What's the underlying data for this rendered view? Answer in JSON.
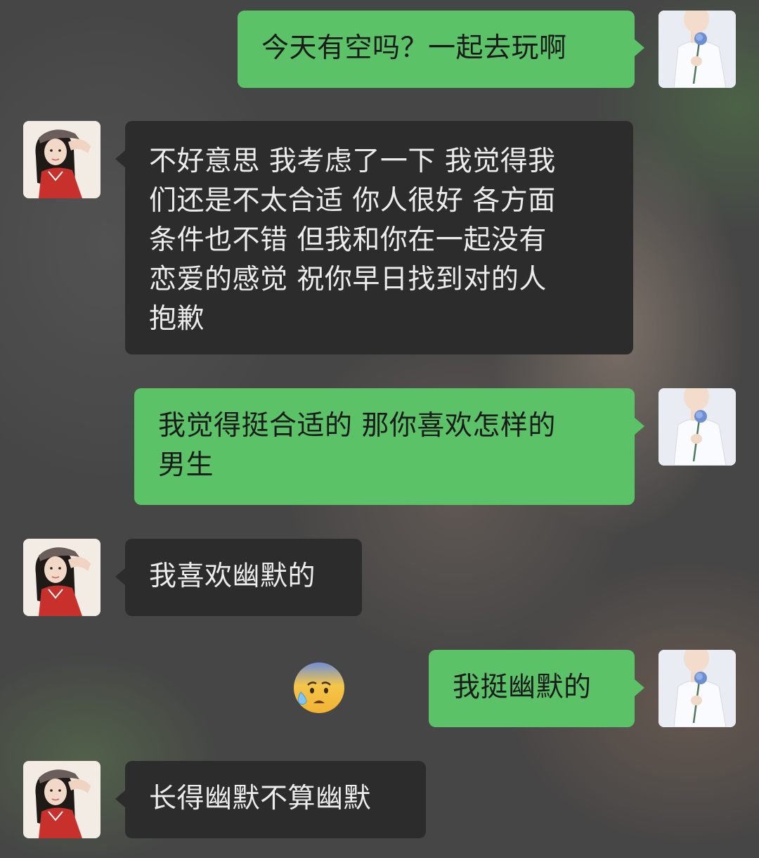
{
  "chat": {
    "messages": [
      {
        "sender": "me",
        "text": "今天有空吗？一起去玩啊"
      },
      {
        "sender": "them",
        "lines": [
          "不好意思 我考虑了一下 我觉得我",
          "们还是不太合适 你人很好 各方面",
          "条件也不错 但我和你在一起没有",
          "恋爱的感觉 祝你早日找到对的人",
          "抱歉"
        ]
      },
      {
        "sender": "me",
        "lines": [
          "我觉得挺合适的 那你喜欢怎样的",
          "男生"
        ]
      },
      {
        "sender": "them",
        "text": "我喜欢幽默的"
      },
      {
        "sender": "me",
        "text": "我挺幽默的",
        "reaction_emoji": "anxious-face-with-sweat"
      },
      {
        "sender": "them",
        "text": "长得幽默不算幽默"
      }
    ]
  },
  "avatars": {
    "me": "boy-holding-blue-rose-avatar",
    "them": "girl-with-cap-avatar"
  },
  "colors": {
    "my_bubble": "#5bc268",
    "their_bubble": "#2c2c2c",
    "their_text": "#ececec",
    "my_text": "#1b1b1b"
  }
}
